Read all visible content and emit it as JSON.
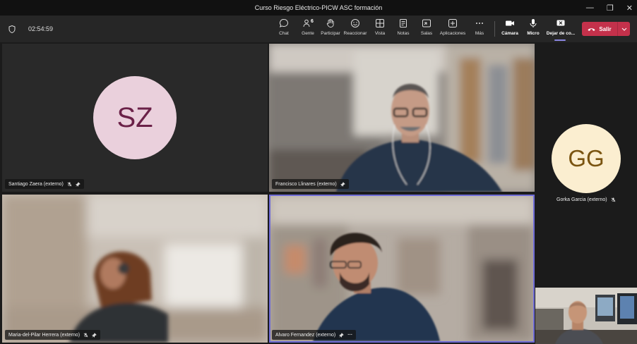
{
  "window": {
    "title": "Curso Riesgo Eléctrico-PICW ASC formación"
  },
  "toolbar": {
    "timer": "02:54:59",
    "buttons": [
      {
        "key": "chat",
        "label": "Chat",
        "icon": "chat-icon"
      },
      {
        "key": "people",
        "label": "Gente",
        "icon": "people-icon",
        "count": "6"
      },
      {
        "key": "raise",
        "label": "Participar",
        "icon": "raise-hand-icon"
      },
      {
        "key": "react",
        "label": "Reaccionar",
        "icon": "smile-icon"
      },
      {
        "key": "view",
        "label": "Vista",
        "icon": "grid-icon"
      },
      {
        "key": "notes",
        "label": "Notas",
        "icon": "notes-icon"
      },
      {
        "key": "rooms",
        "label": "Salas",
        "icon": "breakout-icon"
      },
      {
        "key": "apps",
        "label": "Aplicaciones",
        "icon": "plus-icon"
      },
      {
        "key": "more",
        "label": "Más",
        "icon": "more-icon"
      },
      {
        "key": "camera",
        "label": "Cámara",
        "icon": "camera-icon"
      },
      {
        "key": "mic",
        "label": "Micro",
        "icon": "mic-icon"
      },
      {
        "key": "share",
        "label": "Dejar de co...",
        "icon": "stop-share-icon"
      }
    ],
    "leave_label": "Salir",
    "leave_color": "#c4314b"
  },
  "participants": {
    "santiago": {
      "name": "Santiago Zaera (externo)",
      "initials": "SZ",
      "avatar_bg": "#ead0dc",
      "avatar_fg": "#6b2148"
    },
    "francisco": {
      "name": "Francisco Llinares (externo)"
    },
    "gorka": {
      "name": "Gorka Garcia (externo)",
      "initials": "GG",
      "avatar_bg": "#fbeed0",
      "avatar_fg": "#7a5410"
    },
    "maria": {
      "name": "Maria-del-Pilar Herrera (externo)"
    },
    "alvaro": {
      "name": "Alvaro Fernandez (externo)",
      "more": "···"
    }
  },
  "colors": {
    "active_speaker_border": "#6f6bd6",
    "background": "#1b1b1b"
  }
}
